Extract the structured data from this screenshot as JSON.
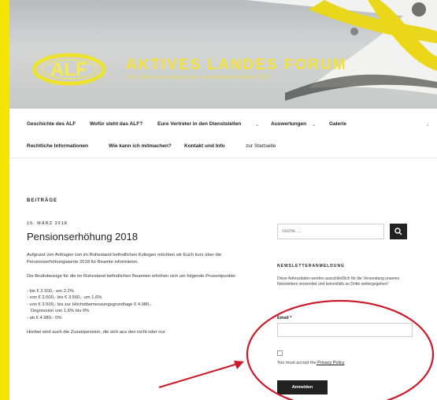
{
  "header": {
    "logo_text": "ALF",
    "site_title": "AKTIVES LANDES FORUM",
    "tagline": "Der Seniorenverband des Landesbediensteten OÖ"
  },
  "nav": {
    "row1": [
      {
        "label": "Geschichte des ALF",
        "dropdown": false
      },
      {
        "label": "Wofür steht das ALF?",
        "dropdown": false
      },
      {
        "label": "Eure Vertreter in den Dienststellen",
        "dropdown": true
      },
      {
        "label": "Auswertungen",
        "dropdown": true
      },
      {
        "label": "Galerie",
        "dropdown": false
      }
    ],
    "row2": [
      {
        "label": "Rechtliche Informationen"
      },
      {
        "label": "Wie kann ich mitmachen?"
      },
      {
        "label": "Kontakt und Info"
      },
      {
        "label": "zur Startseite"
      }
    ],
    "scroll_icon": "arrow-down-icon"
  },
  "main": {
    "section_label": "BEITRÄGE",
    "post": {
      "date": "15. MÄRZ 2018",
      "title": "Pensionserhöhung 2018",
      "para1": "Aufgrund von Anfragen von im Ruhestand befindlichen Kollegen möchten wir Euch kurz über die Pensionserhöhungswerte 2018 für Beamte informieren.",
      "para2": "Die Bruttobezüge für die im Ruhestand befindlichen Beamten erhöhen sich um folgende Prozentpunkte:",
      "list": [
        "- bis € 2.500,- um 2,2%",
        "- von € 2.500,- bis € 3.500,- um 1,6%",
        "- von € 3.500,- bis zur Höchstbemessungsgrundlage € 4.980,- ",
        "  Degression von 1,6% bis 0%",
        "- ab € 4.980,- 0%"
      ],
      "para3": "Hierbei wird auch die Zusatzpension, die sich aus den nicht oder nur"
    }
  },
  "sidebar": {
    "search_placeholder": "Suche …",
    "newsletter_title": "NEWSLETTERANMELDUNG",
    "newsletter_text": "Diese Adressdaten werden ausschließlich für die Versendung unseres Newsletters verwendet und keinesfalls an Dritte weitergegeben!",
    "email_label": "Email *",
    "consent_prefix": "You must ",
    "consent_middle": "accept the",
    "consent_rest": " Privacy Policy",
    "consent_text": "You must accept the Privacy Policy",
    "submit_label": "Anmelden"
  },
  "colors": {
    "frame_yellow": "#f5e400",
    "annotation_red": "#cc1a2b",
    "title_yellow": "#f3e23a"
  }
}
